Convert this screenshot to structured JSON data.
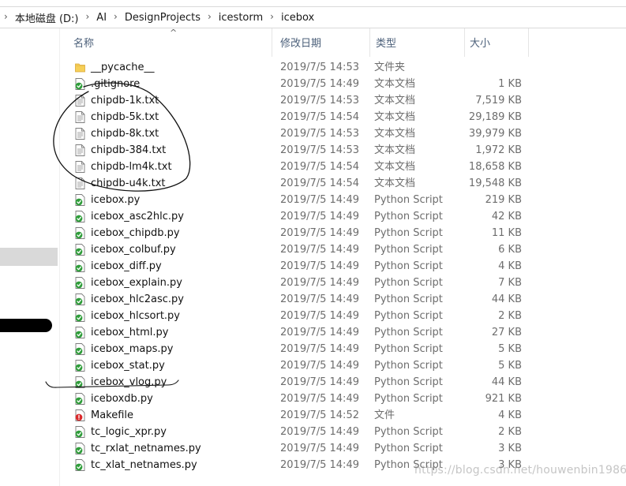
{
  "breadcrumb": {
    "items": [
      "本地磁盘 (D:)",
      "AI",
      "DesignProjects",
      "icestorm",
      "icebox"
    ],
    "separator": "›"
  },
  "columns": {
    "name": "名称",
    "date": "修改日期",
    "type": "类型",
    "size": "大小",
    "sort_indicator": "^"
  },
  "files": [
    {
      "name": "__pycache__",
      "date": "2019/7/5 14:53",
      "type": "文件夹",
      "size": "",
      "icon": "folder-icon"
    },
    {
      "name": ".gitignore",
      "date": "2019/7/5 14:49",
      "type": "文本文档",
      "size": "1 KB",
      "icon": "python-script-icon"
    },
    {
      "name": "chipdb-1k.txt",
      "date": "2019/7/5 14:53",
      "type": "文本文档",
      "size": "7,519 KB",
      "icon": "text-document-icon"
    },
    {
      "name": "chipdb-5k.txt",
      "date": "2019/7/5 14:54",
      "type": "文本文档",
      "size": "29,189 KB",
      "icon": "text-document-icon"
    },
    {
      "name": "chipdb-8k.txt",
      "date": "2019/7/5 14:53",
      "type": "文本文档",
      "size": "39,979 KB",
      "icon": "text-document-icon"
    },
    {
      "name": "chipdb-384.txt",
      "date": "2019/7/5 14:53",
      "type": "文本文档",
      "size": "1,972 KB",
      "icon": "text-document-icon"
    },
    {
      "name": "chipdb-lm4k.txt",
      "date": "2019/7/5 14:54",
      "type": "文本文档",
      "size": "18,658 KB",
      "icon": "text-document-icon"
    },
    {
      "name": "chipdb-u4k.txt",
      "date": "2019/7/5 14:54",
      "type": "文本文档",
      "size": "19,548 KB",
      "icon": "text-document-icon"
    },
    {
      "name": "icebox.py",
      "date": "2019/7/5 14:49",
      "type": "Python Script",
      "size": "219 KB",
      "icon": "python-script-icon"
    },
    {
      "name": "icebox_asc2hlc.py",
      "date": "2019/7/5 14:49",
      "type": "Python Script",
      "size": "42 KB",
      "icon": "python-script-icon"
    },
    {
      "name": "icebox_chipdb.py",
      "date": "2019/7/5 14:49",
      "type": "Python Script",
      "size": "11 KB",
      "icon": "python-script-icon"
    },
    {
      "name": "icebox_colbuf.py",
      "date": "2019/7/5 14:49",
      "type": "Python Script",
      "size": "6 KB",
      "icon": "python-script-icon"
    },
    {
      "name": "icebox_diff.py",
      "date": "2019/7/5 14:49",
      "type": "Python Script",
      "size": "4 KB",
      "icon": "python-script-icon"
    },
    {
      "name": "icebox_explain.py",
      "date": "2019/7/5 14:49",
      "type": "Python Script",
      "size": "7 KB",
      "icon": "python-script-icon"
    },
    {
      "name": "icebox_hlc2asc.py",
      "date": "2019/7/5 14:49",
      "type": "Python Script",
      "size": "44 KB",
      "icon": "python-script-icon"
    },
    {
      "name": "icebox_hlcsort.py",
      "date": "2019/7/5 14:49",
      "type": "Python Script",
      "size": "2 KB",
      "icon": "python-script-icon"
    },
    {
      "name": "icebox_html.py",
      "date": "2019/7/5 14:49",
      "type": "Python Script",
      "size": "27 KB",
      "icon": "python-script-icon"
    },
    {
      "name": "icebox_maps.py",
      "date": "2019/7/5 14:49",
      "type": "Python Script",
      "size": "5 KB",
      "icon": "python-script-icon"
    },
    {
      "name": "icebox_stat.py",
      "date": "2019/7/5 14:49",
      "type": "Python Script",
      "size": "5 KB",
      "icon": "python-script-icon"
    },
    {
      "name": "icebox_vlog.py",
      "date": "2019/7/5 14:49",
      "type": "Python Script",
      "size": "44 KB",
      "icon": "python-script-icon"
    },
    {
      "name": "iceboxdb.py",
      "date": "2019/7/5 14:49",
      "type": "Python Script",
      "size": "921 KB",
      "icon": "python-script-icon"
    },
    {
      "name": "Makefile",
      "date": "2019/7/5 14:52",
      "type": "文件",
      "size": "4 KB",
      "icon": "unknown-file-icon"
    },
    {
      "name": "tc_logic_xpr.py",
      "date": "2019/7/5 14:49",
      "type": "Python Script",
      "size": "2 KB",
      "icon": "python-script-icon"
    },
    {
      "name": "tc_rxlat_netnames.py",
      "date": "2019/7/5 14:49",
      "type": "Python Script",
      "size": "3 KB",
      "icon": "python-script-icon"
    },
    {
      "name": "tc_xlat_netnames.py",
      "date": "2019/7/5 14:49",
      "type": "Python Script",
      "size": "3 KB",
      "icon": "python-script-icon"
    }
  ],
  "watermark": "https://blog.csdn.net/houwenbin1986",
  "colors": {
    "header_text": "#4c607a",
    "meta_text": "#6d6d6d",
    "folder_yellow": "#f6cf57",
    "python_green": "#2f9d3a",
    "error_red": "#d9292b"
  }
}
